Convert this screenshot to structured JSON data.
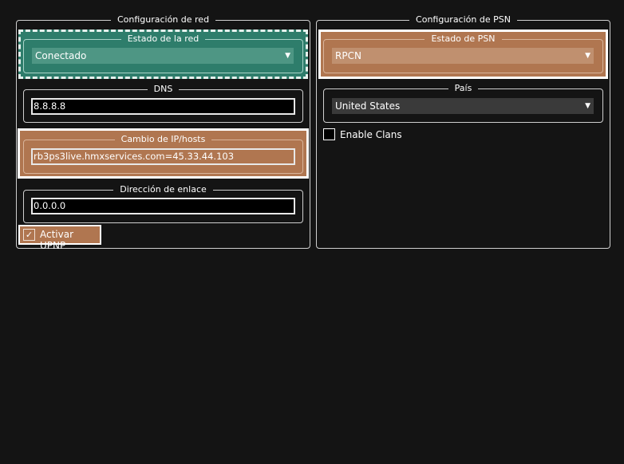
{
  "network": {
    "title": "Configuración de red",
    "status": {
      "title": "Estado de la red",
      "value": "Conectado"
    },
    "dns": {
      "title": "DNS",
      "value": "8.8.8.8"
    },
    "ip_swap": {
      "title": "Cambio de IP/hosts",
      "value": "rb3ps3live.hmxservices.com=45.33.44.103"
    },
    "bind_address": {
      "title": "Dirección de enlace",
      "value": "0.0.0.0"
    },
    "upnp": {
      "label": "Activar UPNP",
      "checked": true
    }
  },
  "psn": {
    "title": "Configuración de PSN",
    "status": {
      "title": "Estado de PSN",
      "value": "RPCN"
    },
    "country": {
      "title": "País",
      "value": "United States"
    },
    "clans": {
      "label": "Enable Clans",
      "checked": false
    }
  },
  "colors": {
    "background": "#141414",
    "highlight_teal": "#2e7d6b",
    "highlight_brown": "#b07650"
  }
}
